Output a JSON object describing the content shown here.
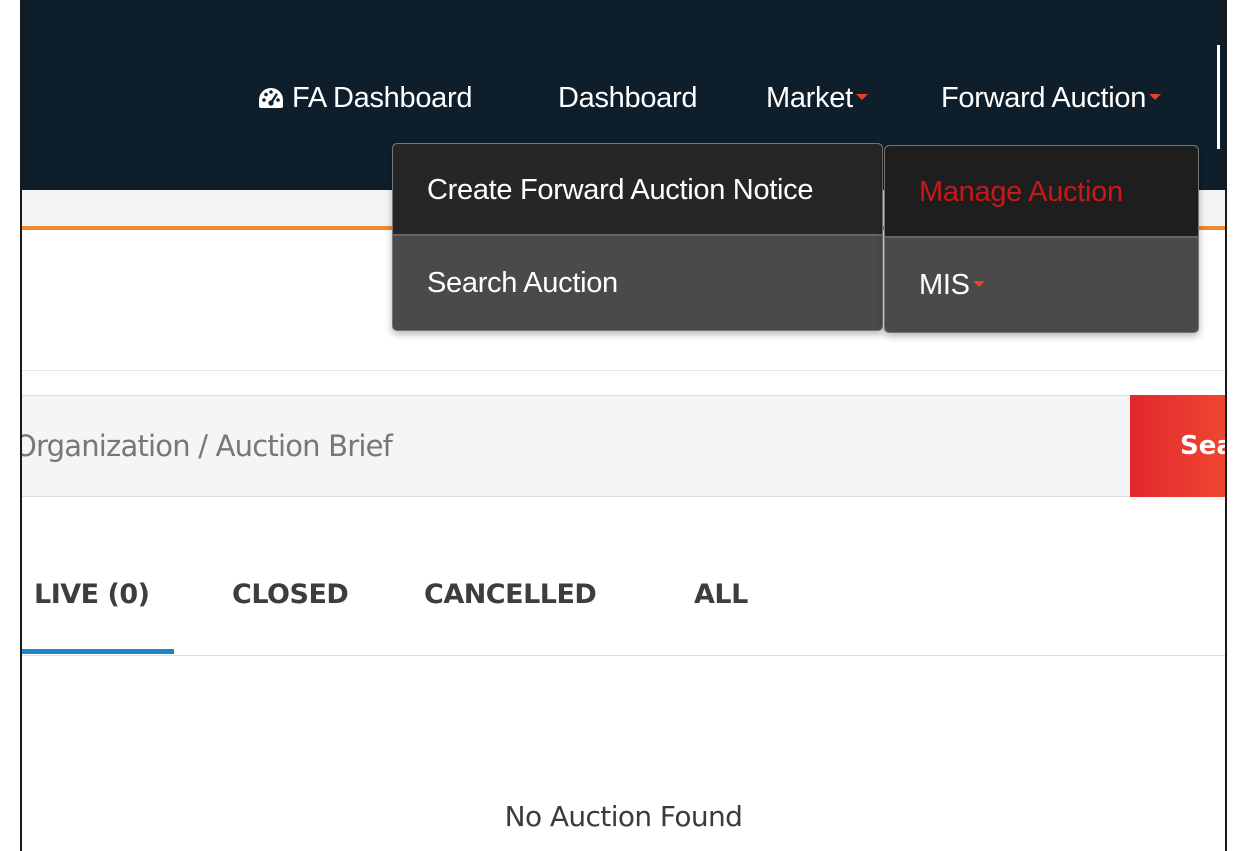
{
  "navbar": {
    "items": [
      {
        "label": "FA Dashboard",
        "icon": "dashboard-gauge-icon"
      },
      {
        "label": "Dashboard"
      },
      {
        "label": "Market",
        "has_caret": true
      },
      {
        "label": "Forward Auction",
        "has_caret": true
      }
    ]
  },
  "dropdown_forward_auction": {
    "items": [
      {
        "label": "Create Forward Auction Notice"
      },
      {
        "label": "Search Auction"
      }
    ]
  },
  "dropdown_manage": {
    "items": [
      {
        "label": "Manage Auction",
        "active": true
      },
      {
        "label": "MIS",
        "has_caret": true
      }
    ]
  },
  "search": {
    "placeholder": "Organization / Auction Brief",
    "button_label": "Search"
  },
  "tabs": [
    {
      "label": "LIVE (0)",
      "active": true
    },
    {
      "label": "CLOSED"
    },
    {
      "label": "CANCELLED"
    },
    {
      "label": "ALL"
    }
  ],
  "empty_message": "No Auction Found",
  "colors": {
    "navbar_bg": "#0e1f2b",
    "accent_orange": "#f0882f",
    "caret_red": "#e8412c",
    "active_menu_red": "#c81818",
    "search_button_red": "#e3262f",
    "tab_underline_blue": "#1f85c6",
    "dropdown_bg": "#4a4a4a"
  }
}
